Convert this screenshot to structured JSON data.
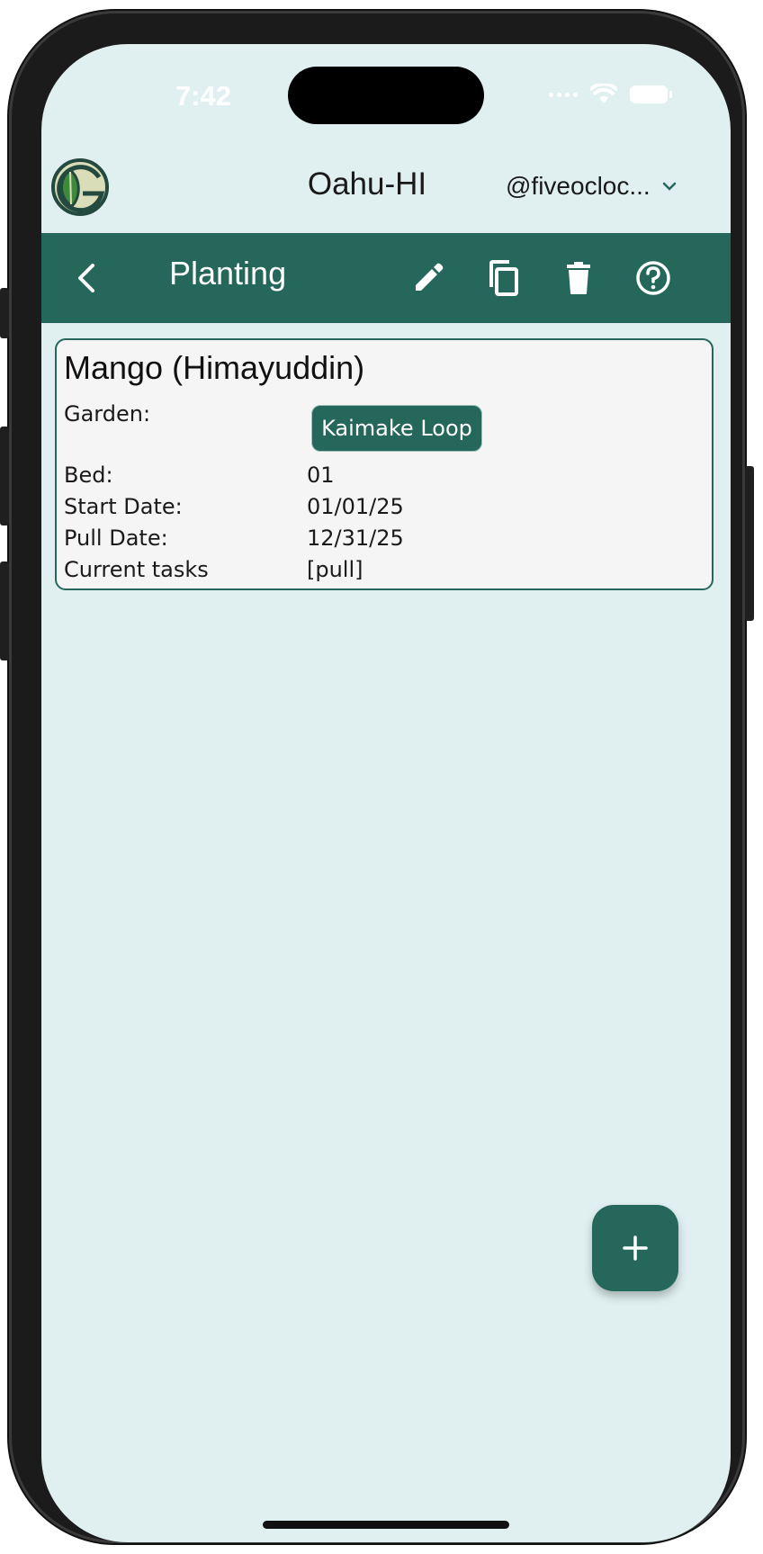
{
  "status_bar": {
    "time": "7:42"
  },
  "header": {
    "logo_icon": "garden-logo-icon",
    "region": "Oahu-HI",
    "account": "@fiveocloc...",
    "account_icon": "chevron-down-icon"
  },
  "toolbar": {
    "title": "Planting",
    "back_icon": "back-arrow-icon",
    "edit_icon": "pencil-icon",
    "copy_icon": "copy-icon",
    "delete_icon": "trash-icon",
    "help_icon": "help-circle-icon"
  },
  "planting": {
    "name": "Mango (Himayuddin)",
    "rows": [
      {
        "label": "Garden:",
        "value": "Kaimake Loop"
      },
      {
        "label": "Bed:",
        "value": "01"
      },
      {
        "label": "Start Date:",
        "value": "01/01/25"
      },
      {
        "label": "Pull Date:",
        "value": "12/31/25"
      },
      {
        "label": "Current tasks",
        "value": "[pull]"
      }
    ]
  },
  "fab": {
    "icon": "plus-icon"
  },
  "colors": {
    "primary": "#25675b",
    "background": "#e0f0f0",
    "card": "#f5f5f5"
  }
}
